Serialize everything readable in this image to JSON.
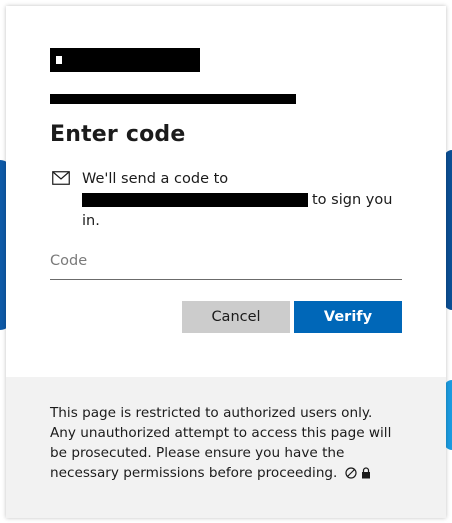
{
  "dialog": {
    "title": "Enter code",
    "message_prefix": "We'll send a code to",
    "message_suffix": "to sign you in.",
    "code_placeholder": "Code",
    "cancel_label": "Cancel",
    "verify_label": "Verify"
  },
  "footer": {
    "notice": "This page is restricted to authorized users only. Any unauthorized attempt to access this page will be prosecuted. Please ensure you have the necessary permissions before proceeding."
  },
  "colors": {
    "accent": "#0067b8",
    "cancel_bg": "#cccccc",
    "footer_bg": "#f2f2f2"
  },
  "icons": {
    "message": "mail-icon",
    "footer": [
      "no-entry-icon",
      "lock-icon"
    ]
  }
}
